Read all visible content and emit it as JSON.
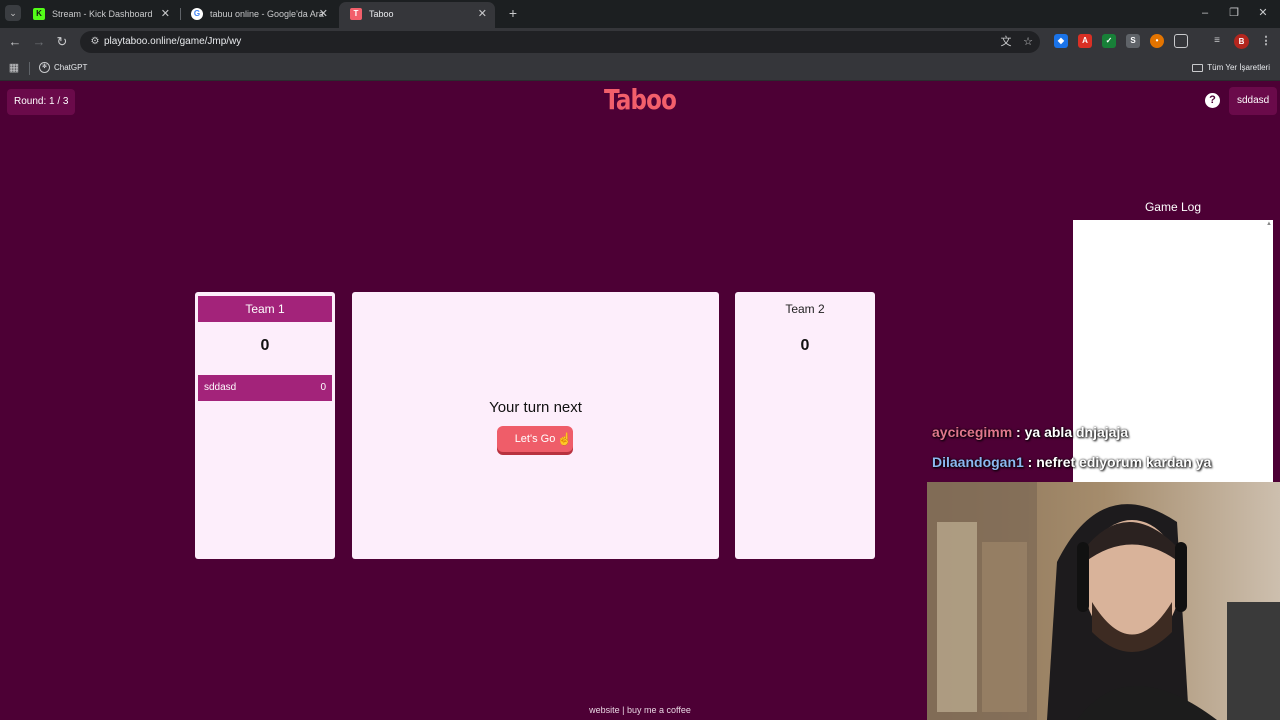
{
  "browser": {
    "tabs": [
      {
        "title": "Stream - Kick Dashboard",
        "favicon": "K",
        "color": "#53fc18"
      },
      {
        "title": "tabuu online - Google'da Ara",
        "favicon": "G",
        "color": "#4285f4"
      },
      {
        "title": "Taboo",
        "favicon": "T",
        "color": "#f25f6b",
        "active": true
      }
    ],
    "url": "playtaboo.online/game/Jmp/wy",
    "bookmarks": [
      {
        "label": "ChatGPT"
      }
    ],
    "bookmarks_folder": "Tüm Yer İşaretleri",
    "profile_initial": "B"
  },
  "game": {
    "round_label": "Round: 1 / 3",
    "logo": "Taboo",
    "username": "sddasd",
    "help_icon": "?",
    "game_log_title": "Game Log",
    "teams": [
      {
        "name": "Team 1",
        "score": "0",
        "players": [
          {
            "name": "sddasd",
            "score": "0"
          }
        ]
      },
      {
        "name": "Team 2",
        "score": "0",
        "players": []
      }
    ],
    "turn_text": "Your turn next",
    "button_label": "Let's Go",
    "footer_website": "website",
    "footer_separator": " | ",
    "footer_coffee": "buy me a coffee"
  },
  "stream_chat": [
    {
      "user": "aycicegimm",
      "separator": " : ",
      "message": "ya abla dnjajaja"
    },
    {
      "user": "Dilaandogan1",
      "separator": " : ",
      "message": "nefret ediyorum kardan ya"
    }
  ],
  "colors": {
    "page_bg": "#4d0035",
    "accent": "#a3237a",
    "logo": "#f25f6b",
    "button": "#ef5d69",
    "panel_bg": "#fdeefb"
  }
}
